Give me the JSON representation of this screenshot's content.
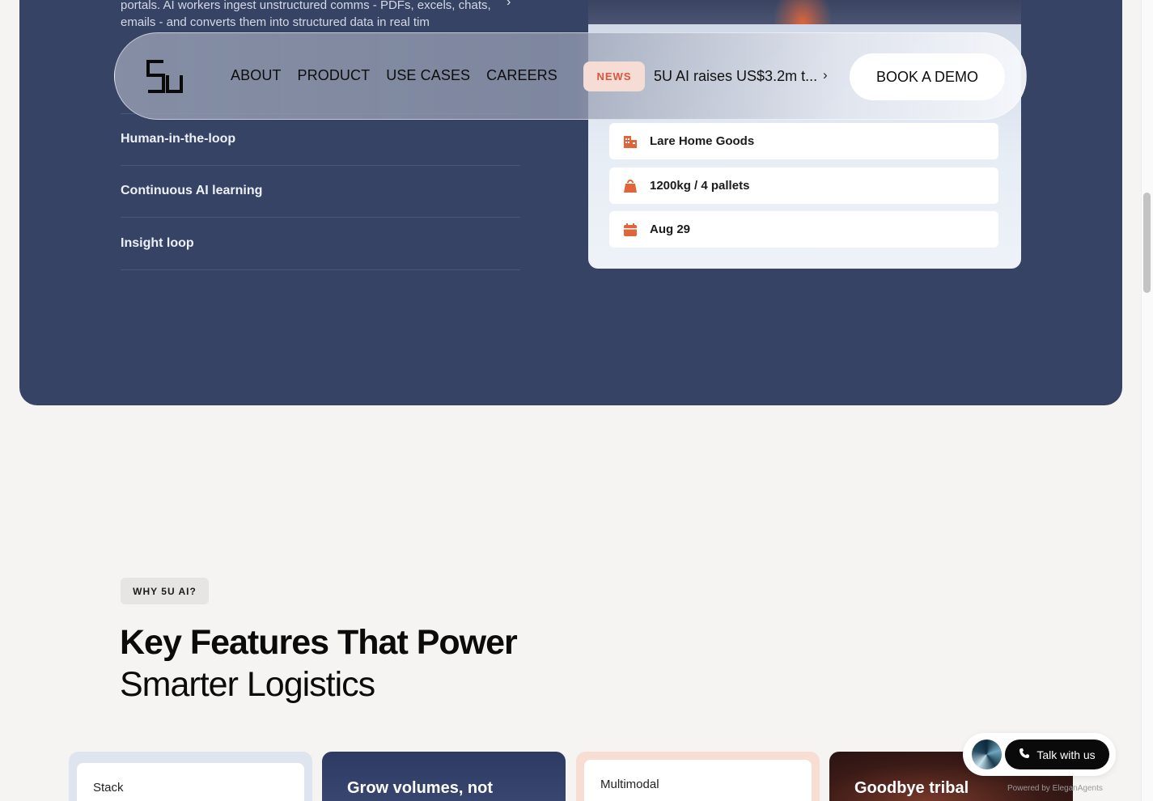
{
  "hero": {
    "description": "portals. AI workers ingest unstructured comms - PDFs, excels, chats, emails - and converts them into structured data in real tim",
    "features": [
      "Human-in-the-loop",
      "Continuous AI learning",
      "Insight loop"
    ],
    "info_rows": [
      {
        "icon": "building-icon",
        "text": "Lare Home Goods"
      },
      {
        "icon": "weight-icon",
        "text": "1200kg / 4 pallets"
      },
      {
        "icon": "calendar-icon",
        "text": "Aug 29"
      }
    ],
    "accent_color": "#e0653b"
  },
  "nav": {
    "logo_icon": "5u-logo-icon",
    "links": [
      "ABOUT",
      "PRODUCT",
      "USE CASES",
      "CAREERS"
    ],
    "news_badge": "NEWS",
    "news_text": "5U AI raises US$3.2m t...",
    "news_arrow": "›",
    "demo_label": "BOOK A DEMO"
  },
  "section": {
    "badge": "WHY 5U AI?",
    "headline_bold": "Key Features That Power",
    "headline_light": "Smarter Logistics"
  },
  "cards": [
    {
      "label": "Stack"
    },
    {
      "title": "Grow volumes, not"
    },
    {
      "label": "Multimodal"
    },
    {
      "title": "Goodbye tribal"
    }
  ],
  "widget": {
    "talk_label": "Talk with us",
    "powered_by": "Powered by EleganAgents"
  }
}
